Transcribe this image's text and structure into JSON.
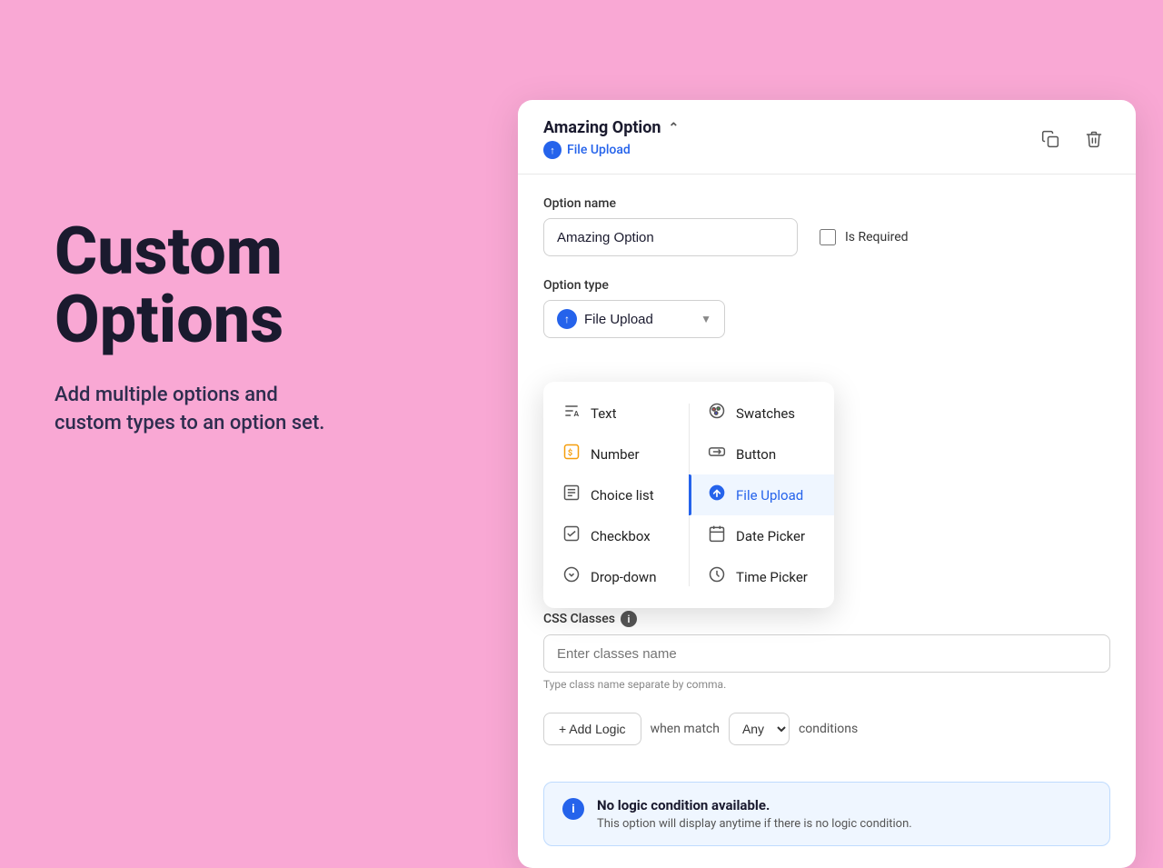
{
  "left": {
    "title_line1": "Custom",
    "title_line2": "Options",
    "subtitle": "Add multiple options and\ncustom types to an option set."
  },
  "card": {
    "option_name_label": "Option name",
    "option_name_value": "Amazing Option",
    "option_title": "Amazing Option",
    "option_type_label": "Option type",
    "option_type_value": "File Upload",
    "is_required_label": "Is Required",
    "copy_icon": "⧉",
    "delete_icon": "🗑",
    "css_classes_label": "CSS Classes",
    "css_classes_placeholder": "Enter classes name",
    "css_classes_hint": "Type class name separate by comma.",
    "logic_when_match": "when match",
    "logic_any": "Any",
    "logic_conditions": "conditions",
    "info_title": "No logic condition available.",
    "info_desc": "This option will display anytime if there is no logic condition."
  },
  "dropdown": {
    "items_left": [
      {
        "id": "text",
        "label": "Text",
        "icon": "text"
      },
      {
        "id": "number",
        "label": "Number",
        "icon": "number"
      },
      {
        "id": "choice-list",
        "label": "Choice list",
        "icon": "choice"
      },
      {
        "id": "checkbox",
        "label": "Checkbox",
        "icon": "checkbox"
      },
      {
        "id": "dropdown",
        "label": "Drop-down",
        "icon": "dropdown"
      }
    ],
    "items_right": [
      {
        "id": "swatches",
        "label": "Swatches",
        "icon": "swatches"
      },
      {
        "id": "button",
        "label": "Button",
        "icon": "button"
      },
      {
        "id": "file-upload",
        "label": "File Upload",
        "icon": "upload",
        "active": true
      },
      {
        "id": "date-picker",
        "label": "Date Picker",
        "icon": "calendar"
      },
      {
        "id": "time-picker",
        "label": "Time Picker",
        "icon": "clock"
      }
    ]
  }
}
